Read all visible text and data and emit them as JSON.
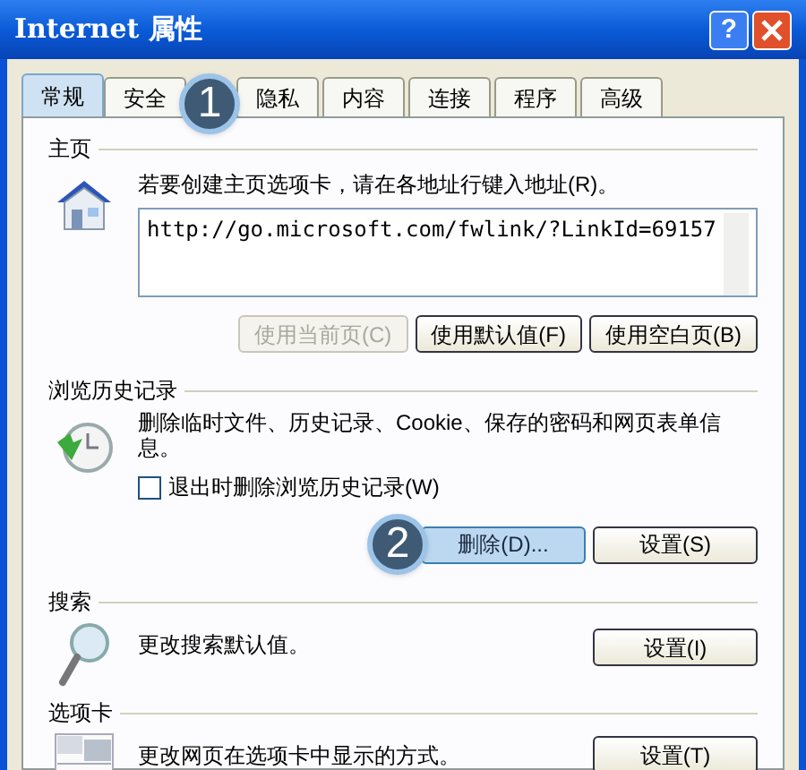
{
  "window": {
    "title": "Internet 属性",
    "help": "?"
  },
  "tabs": [
    {
      "label": "常规",
      "selected": true
    },
    {
      "label": "安全",
      "selected": false,
      "callout": "1"
    },
    {
      "label": "隐私",
      "selected": false
    },
    {
      "label": "内容",
      "selected": false
    },
    {
      "label": "连接",
      "selected": false
    },
    {
      "label": "程序",
      "selected": false
    },
    {
      "label": "高级",
      "selected": false
    }
  ],
  "home": {
    "heading": "主页",
    "description": "若要创建主页选项卡，请在各地址行键入地址(R)。",
    "address": "http://go.microsoft.com/fwlink/?LinkId=69157",
    "buttons": [
      {
        "label": "使用当前页(C)",
        "disabled": true
      },
      {
        "label": "使用默认值(F)",
        "disabled": false
      },
      {
        "label": "使用空白页(B)",
        "disabled": false
      }
    ]
  },
  "history": {
    "heading": "浏览历史记录",
    "description": "删除临时文件、历史记录、Cookie、保存的密码和网页表单信息。",
    "checkbox": {
      "label": "退出时删除浏览历史记录(W)",
      "checked": false
    },
    "buttons": [
      {
        "label": "删除(D)...",
        "callout": "2",
        "highlighted": true
      },
      {
        "label": "设置(S)",
        "highlighted": false
      }
    ]
  },
  "search": {
    "heading": "搜索",
    "description": "更改搜索默认值。",
    "button": "设置(I)"
  },
  "tabs_section": {
    "heading": "选项卡",
    "description": "更改网页在选项卡中显示的方式。",
    "button": "设置(T)"
  }
}
